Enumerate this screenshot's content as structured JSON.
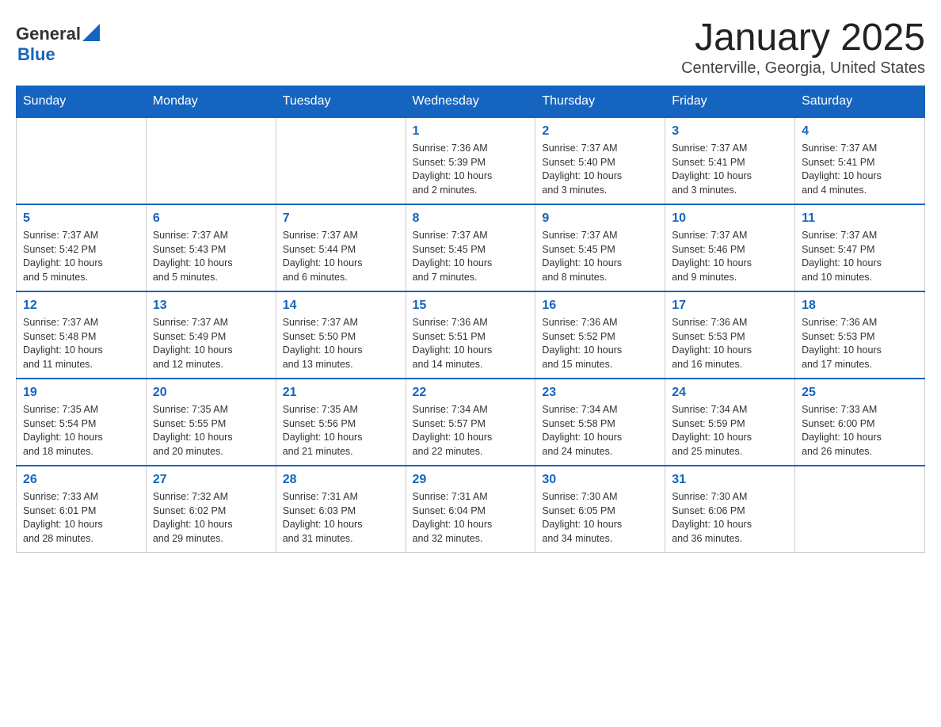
{
  "header": {
    "logo_general": "General",
    "logo_blue": "Blue",
    "main_title": "January 2025",
    "subtitle": "Centerville, Georgia, United States"
  },
  "days_of_week": [
    "Sunday",
    "Monday",
    "Tuesday",
    "Wednesday",
    "Thursday",
    "Friday",
    "Saturday"
  ],
  "weeks": [
    [
      {
        "day": "",
        "info": ""
      },
      {
        "day": "",
        "info": ""
      },
      {
        "day": "",
        "info": ""
      },
      {
        "day": "1",
        "info": "Sunrise: 7:36 AM\nSunset: 5:39 PM\nDaylight: 10 hours\nand 2 minutes."
      },
      {
        "day": "2",
        "info": "Sunrise: 7:37 AM\nSunset: 5:40 PM\nDaylight: 10 hours\nand 3 minutes."
      },
      {
        "day": "3",
        "info": "Sunrise: 7:37 AM\nSunset: 5:41 PM\nDaylight: 10 hours\nand 3 minutes."
      },
      {
        "day": "4",
        "info": "Sunrise: 7:37 AM\nSunset: 5:41 PM\nDaylight: 10 hours\nand 4 minutes."
      }
    ],
    [
      {
        "day": "5",
        "info": "Sunrise: 7:37 AM\nSunset: 5:42 PM\nDaylight: 10 hours\nand 5 minutes."
      },
      {
        "day": "6",
        "info": "Sunrise: 7:37 AM\nSunset: 5:43 PM\nDaylight: 10 hours\nand 5 minutes."
      },
      {
        "day": "7",
        "info": "Sunrise: 7:37 AM\nSunset: 5:44 PM\nDaylight: 10 hours\nand 6 minutes."
      },
      {
        "day": "8",
        "info": "Sunrise: 7:37 AM\nSunset: 5:45 PM\nDaylight: 10 hours\nand 7 minutes."
      },
      {
        "day": "9",
        "info": "Sunrise: 7:37 AM\nSunset: 5:45 PM\nDaylight: 10 hours\nand 8 minutes."
      },
      {
        "day": "10",
        "info": "Sunrise: 7:37 AM\nSunset: 5:46 PM\nDaylight: 10 hours\nand 9 minutes."
      },
      {
        "day": "11",
        "info": "Sunrise: 7:37 AM\nSunset: 5:47 PM\nDaylight: 10 hours\nand 10 minutes."
      }
    ],
    [
      {
        "day": "12",
        "info": "Sunrise: 7:37 AM\nSunset: 5:48 PM\nDaylight: 10 hours\nand 11 minutes."
      },
      {
        "day": "13",
        "info": "Sunrise: 7:37 AM\nSunset: 5:49 PM\nDaylight: 10 hours\nand 12 minutes."
      },
      {
        "day": "14",
        "info": "Sunrise: 7:37 AM\nSunset: 5:50 PM\nDaylight: 10 hours\nand 13 minutes."
      },
      {
        "day": "15",
        "info": "Sunrise: 7:36 AM\nSunset: 5:51 PM\nDaylight: 10 hours\nand 14 minutes."
      },
      {
        "day": "16",
        "info": "Sunrise: 7:36 AM\nSunset: 5:52 PM\nDaylight: 10 hours\nand 15 minutes."
      },
      {
        "day": "17",
        "info": "Sunrise: 7:36 AM\nSunset: 5:53 PM\nDaylight: 10 hours\nand 16 minutes."
      },
      {
        "day": "18",
        "info": "Sunrise: 7:36 AM\nSunset: 5:53 PM\nDaylight: 10 hours\nand 17 minutes."
      }
    ],
    [
      {
        "day": "19",
        "info": "Sunrise: 7:35 AM\nSunset: 5:54 PM\nDaylight: 10 hours\nand 18 minutes."
      },
      {
        "day": "20",
        "info": "Sunrise: 7:35 AM\nSunset: 5:55 PM\nDaylight: 10 hours\nand 20 minutes."
      },
      {
        "day": "21",
        "info": "Sunrise: 7:35 AM\nSunset: 5:56 PM\nDaylight: 10 hours\nand 21 minutes."
      },
      {
        "day": "22",
        "info": "Sunrise: 7:34 AM\nSunset: 5:57 PM\nDaylight: 10 hours\nand 22 minutes."
      },
      {
        "day": "23",
        "info": "Sunrise: 7:34 AM\nSunset: 5:58 PM\nDaylight: 10 hours\nand 24 minutes."
      },
      {
        "day": "24",
        "info": "Sunrise: 7:34 AM\nSunset: 5:59 PM\nDaylight: 10 hours\nand 25 minutes."
      },
      {
        "day": "25",
        "info": "Sunrise: 7:33 AM\nSunset: 6:00 PM\nDaylight: 10 hours\nand 26 minutes."
      }
    ],
    [
      {
        "day": "26",
        "info": "Sunrise: 7:33 AM\nSunset: 6:01 PM\nDaylight: 10 hours\nand 28 minutes."
      },
      {
        "day": "27",
        "info": "Sunrise: 7:32 AM\nSunset: 6:02 PM\nDaylight: 10 hours\nand 29 minutes."
      },
      {
        "day": "28",
        "info": "Sunrise: 7:31 AM\nSunset: 6:03 PM\nDaylight: 10 hours\nand 31 minutes."
      },
      {
        "day": "29",
        "info": "Sunrise: 7:31 AM\nSunset: 6:04 PM\nDaylight: 10 hours\nand 32 minutes."
      },
      {
        "day": "30",
        "info": "Sunrise: 7:30 AM\nSunset: 6:05 PM\nDaylight: 10 hours\nand 34 minutes."
      },
      {
        "day": "31",
        "info": "Sunrise: 7:30 AM\nSunset: 6:06 PM\nDaylight: 10 hours\nand 36 minutes."
      },
      {
        "day": "",
        "info": ""
      }
    ]
  ]
}
